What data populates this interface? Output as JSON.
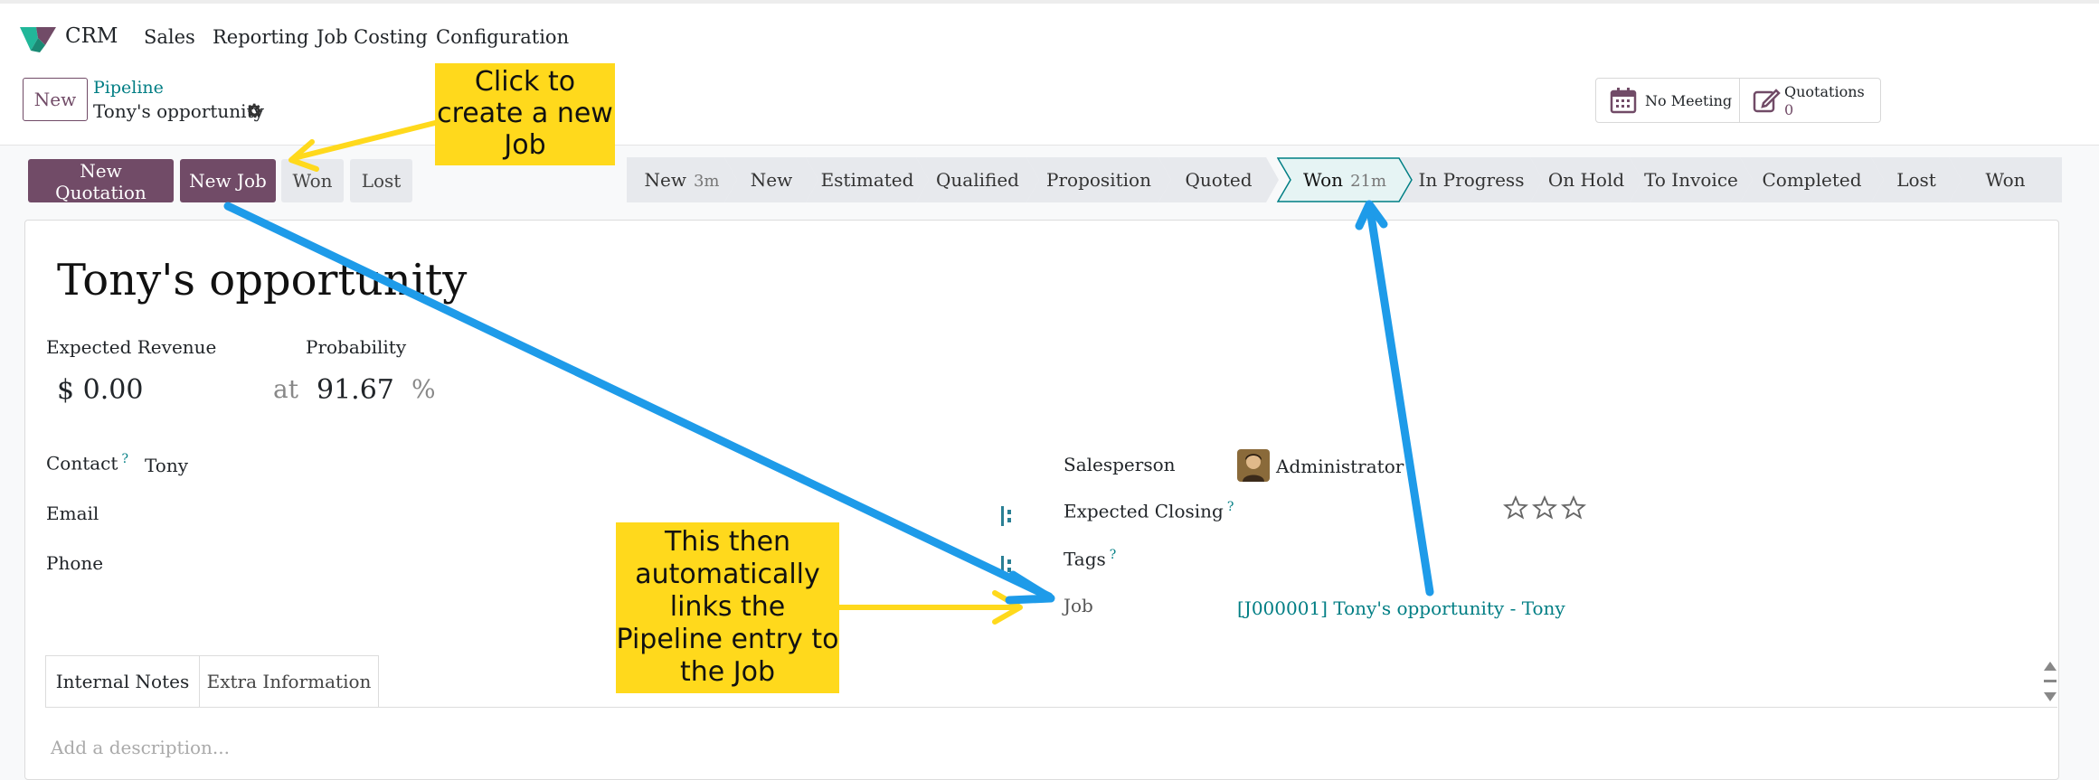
{
  "nav": {
    "brand": "CRM",
    "menu": [
      "Sales",
      "Reporting",
      "Job Costing",
      "Configuration"
    ]
  },
  "control": {
    "new_label": "New",
    "breadcrumb_parent": "Pipeline",
    "breadcrumb_current": "Tony's opportunity",
    "meeting_label": "No Meeting",
    "quotations_label": "Quotations",
    "quotations_count": "0"
  },
  "actions": {
    "new_quotation": "New Quotation",
    "new_job": "New Job",
    "won": "Won",
    "lost": "Lost"
  },
  "stages": [
    {
      "label": "New",
      "duration": "3m"
    },
    {
      "label": "New",
      "duration": ""
    },
    {
      "label": "Estimated",
      "duration": ""
    },
    {
      "label": "Qualified",
      "duration": ""
    },
    {
      "label": "Proposition",
      "duration": ""
    },
    {
      "label": "Quoted",
      "duration": ""
    },
    {
      "label": "Won",
      "duration": "21m",
      "active": true
    },
    {
      "label": "In Progress",
      "duration": ""
    },
    {
      "label": "On Hold",
      "duration": ""
    },
    {
      "label": "To Invoice",
      "duration": ""
    },
    {
      "label": "Completed",
      "duration": ""
    },
    {
      "label": "Lost",
      "duration": ""
    },
    {
      "label": "Won",
      "duration": ""
    }
  ],
  "record": {
    "title": "Tony's opportunity",
    "expected_revenue_label": "Expected Revenue",
    "expected_revenue_value": "$ 0.00",
    "probability_label": "Probability",
    "at_label": "at",
    "probability_value": "91.67",
    "percent_sign": "%",
    "contact_label": "Contact",
    "help_mark": "?",
    "contact_value": "Tony",
    "email_label": "Email",
    "phone_label": "Phone",
    "salesperson_label": "Salesperson",
    "salesperson_value": "Administrator",
    "expected_closing_label": "Expected Closing",
    "priority_stars": 0,
    "tags_label": "Tags",
    "job_label": "Job",
    "job_value": "[J000001] Tony's opportunity - Tony"
  },
  "tabs": [
    "Internal Notes",
    "Extra Information"
  ],
  "notes_placeholder": "Add a description...",
  "callouts": {
    "create_job": [
      "Click to",
      "create a new",
      "Job"
    ],
    "links_job": [
      "This then",
      "automatically",
      "links the",
      "Pipeline entry to",
      "the Job"
    ]
  },
  "colors": {
    "primary": "#714b67",
    "link": "#017e84",
    "callout": "#ffd91c",
    "arrow_blue": "#1e9be9",
    "arrow_yellow": "#ffd91c"
  }
}
